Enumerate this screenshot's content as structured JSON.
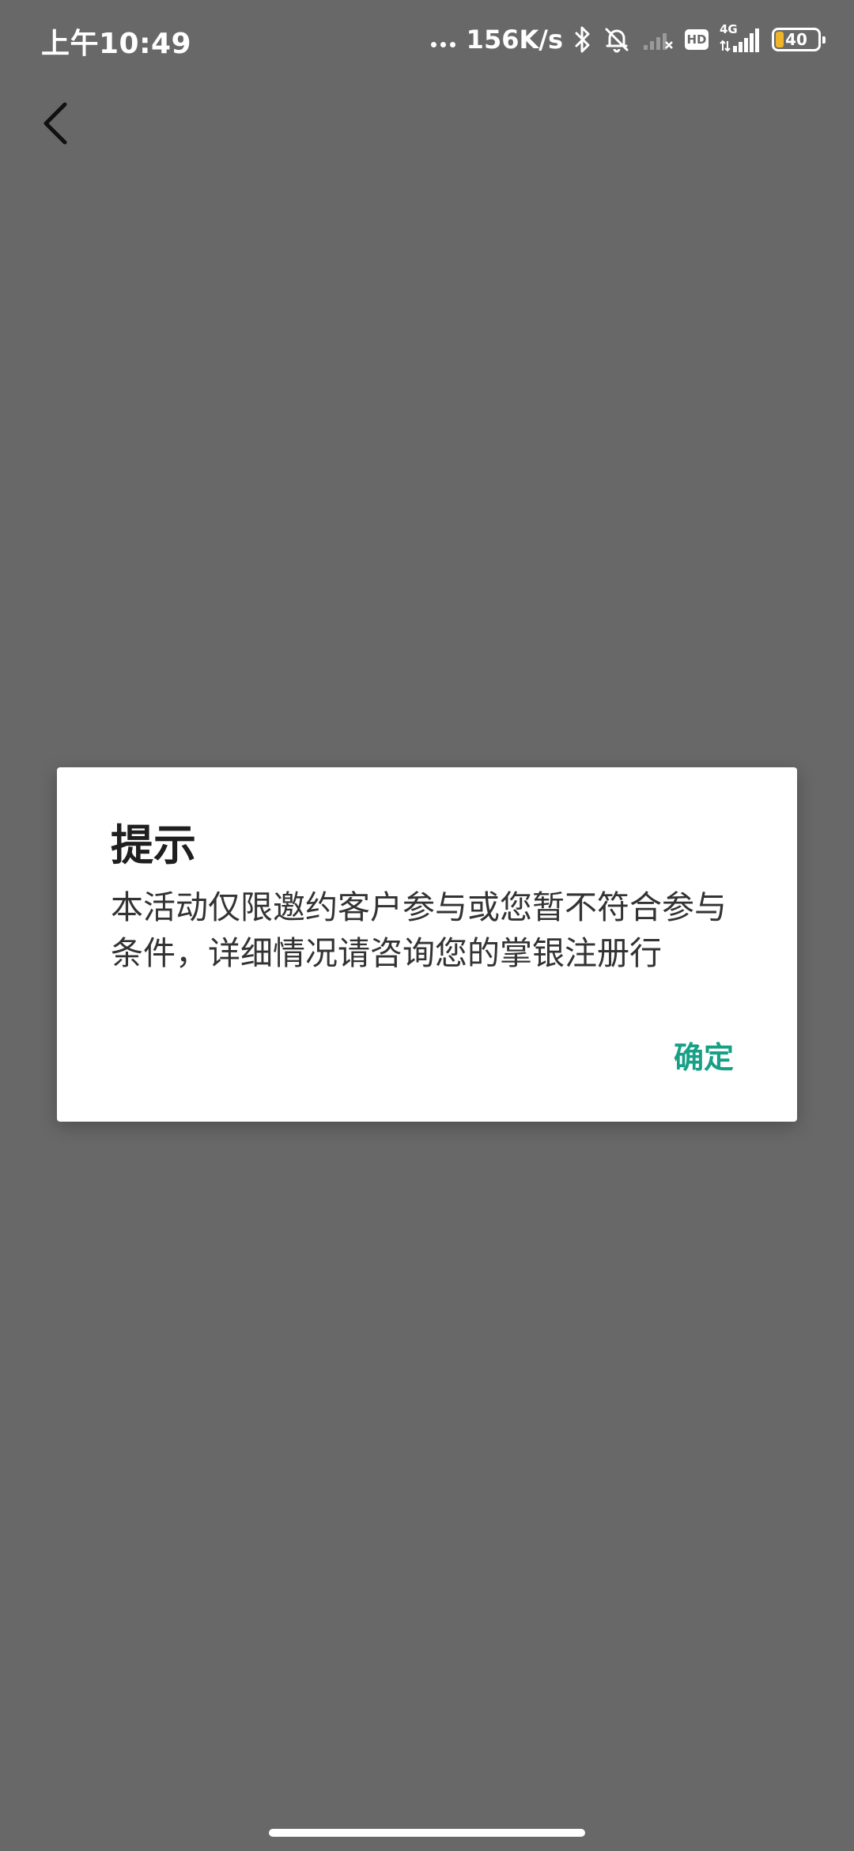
{
  "status_bar": {
    "time": "上午10:49",
    "speed": "156K/s",
    "hd_label": "HD",
    "network_type": "4G",
    "battery_level": "40"
  },
  "icons": {
    "back": "chevron-left-icon",
    "bluetooth": "bluetooth-icon",
    "mute": "bell-off-icon",
    "signal_1": "signal-off-icon",
    "signal_2": "signal-icon",
    "battery": "battery-icon"
  },
  "dialog": {
    "title": "提示",
    "message": "本活动仅限邀约客户参与或您暂不符合参与条件，详细情况请咨询您的掌银注册行",
    "confirm_label": "确定"
  },
  "colors": {
    "background": "#686868",
    "accent": "#16a085",
    "battery_fill": "#f0b429"
  }
}
